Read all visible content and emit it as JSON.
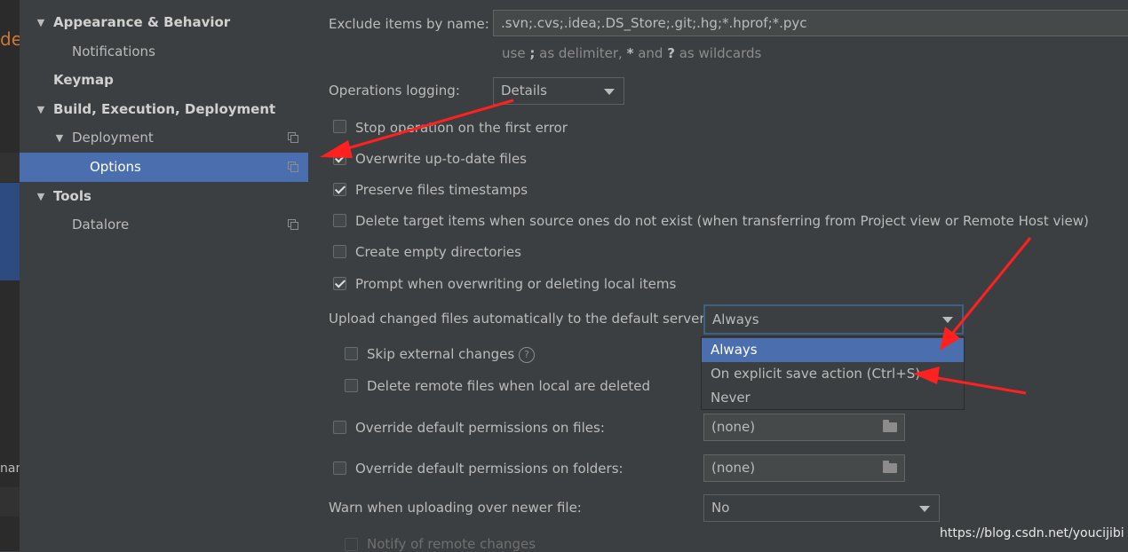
{
  "edge": {
    "fragment_text": "de",
    "tab_fragment": "nan"
  },
  "sidebar": {
    "items": [
      {
        "label": "Appearance & Behavior",
        "bold": true,
        "arrow": "▼"
      },
      {
        "label": "Notifications"
      },
      {
        "label": "Keymap",
        "bold": true
      },
      {
        "label": "Build, Execution, Deployment",
        "bold": true,
        "arrow": "▼"
      },
      {
        "label": "Deployment",
        "arrow": "▼"
      },
      {
        "label": "Options",
        "selected": true
      },
      {
        "label": "Tools",
        "bold": true,
        "arrow": "▼"
      },
      {
        "label": "Datalore"
      }
    ]
  },
  "settings": {
    "exclude": {
      "label": "Exclude items by name:",
      "value": ".svn;.cvs;.idea;.DS_Store;.git;.hg;*.hprof;*.pyc",
      "hint_p1": "use",
      "hint_semicolon": ";",
      "hint_p2": "as delimiter,",
      "hint_star": "*",
      "hint_p3": "and",
      "hint_q": "?",
      "hint_p4": "as wildcards"
    },
    "ops_logging": {
      "label": "Operations logging:",
      "value": "Details"
    },
    "checkboxes": [
      {
        "label": "Stop operation on the first error",
        "checked": false
      },
      {
        "label": "Overwrite up-to-date files",
        "checked": true
      },
      {
        "label": "Preserve files timestamps",
        "checked": true
      },
      {
        "label": "Delete target items when source ones do not exist (when transferring from Project view or Remote Host view)",
        "checked": false
      },
      {
        "label": "Create empty directories",
        "checked": false
      },
      {
        "label": "Prompt when overwriting or deleting local items",
        "checked": true
      }
    ],
    "upload": {
      "label": "Upload changed files automatically to the default server",
      "value": "Always",
      "options": [
        "Always",
        "On explicit save action (Ctrl+S)",
        "Never"
      ],
      "selected_option": "Always"
    },
    "skip_external": {
      "label": "Skip external changes",
      "checked": false,
      "help": "?"
    },
    "delete_remote": {
      "label": "Delete remote files when local are deleted",
      "checked": false
    },
    "perm_files": {
      "label": "Override default permissions on files:",
      "checked": false,
      "value": "(none)"
    },
    "perm_folders": {
      "label": "Override default permissions on folders:",
      "checked": false,
      "value": "(none)"
    },
    "warn_newer": {
      "label": "Warn when uploading over newer file:",
      "value": "No"
    },
    "notify_remote": {
      "label": "Notify of remote changes",
      "checked": false
    }
  },
  "watermark": "https://blog.csdn.net/youcijibi",
  "colors": {
    "selection": "#4b6eaf",
    "annotation_arrow": "#ff2020",
    "background": "#3c3f41"
  }
}
